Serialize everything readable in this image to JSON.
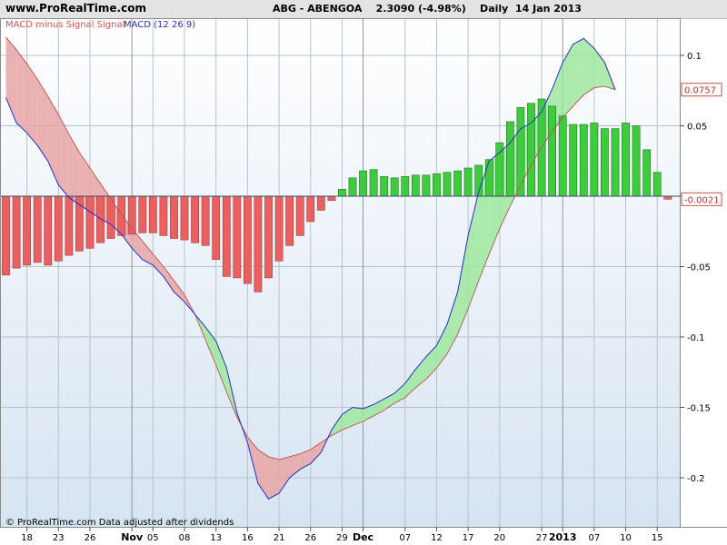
{
  "header": {
    "site": "www.ProRealTime.com",
    "title": "ABG - ABENGOA    2.3090 (-4.98%)    Daily  14 Jan 2013"
  },
  "footer_note": "© ProRealTime.com  Data adjusted after dividends",
  "colors": {
    "macd_line": "#2b2bd9",
    "signal_line": "#c05050",
    "pos_bar": "#3ecb3e",
    "neg_bar": "#e86060",
    "pos_fill": "#9ee89e",
    "neg_fill": "#e8a4a4",
    "grid": "#b8c2cc",
    "bg_top": "#ffffff",
    "bg_bottom": "#d6e4f1"
  },
  "chart_data": {
    "type": "bar",
    "title": "",
    "legend": [
      {
        "label": "MACD minus Signal Signal",
        "color": "#e05050"
      },
      {
        "label": "MACD (12 26 9)",
        "color": "#2b2bd9"
      }
    ],
    "legend_position": "top-left",
    "ylim": [
      -0.235,
      0.115
    ],
    "y_ticks": [
      0.1,
      0.05,
      0,
      -0.05,
      -0.1,
      -0.15,
      -0.2
    ],
    "y_tick_labels": [
      "0.1",
      "0.05",
      "0",
      "-0.05",
      "-0.1",
      "-0.15",
      "-0.2"
    ],
    "value_labels": {
      "macd": "0.0757",
      "histogram": "-0.0021"
    },
    "x_ticks": [
      {
        "label": "18",
        "i": 2
      },
      {
        "label": "23",
        "i": 5
      },
      {
        "label": "26",
        "i": 8
      },
      {
        "label": "Nov",
        "i": 12,
        "bold": true
      },
      {
        "label": "05",
        "i": 14
      },
      {
        "label": "08",
        "i": 17
      },
      {
        "label": "13",
        "i": 20
      },
      {
        "label": "16",
        "i": 23
      },
      {
        "label": "21",
        "i": 26
      },
      {
        "label": "26",
        "i": 29
      },
      {
        "label": "29",
        "i": 32
      },
      {
        "label": "Dec",
        "i": 34,
        "bold": true
      },
      {
        "label": "07",
        "i": 38
      },
      {
        "label": "12",
        "i": 41
      },
      {
        "label": "17",
        "i": 44
      },
      {
        "label": "20",
        "i": 47
      },
      {
        "label": "27",
        "i": 51
      },
      {
        "label": "2013",
        "i": 53,
        "bold": true
      },
      {
        "label": "07",
        "i": 56
      },
      {
        "label": "10",
        "i": 59
      },
      {
        "label": "15",
        "i": 62
      }
    ],
    "grid": true,
    "histogram": [
      -0.056,
      -0.051,
      -0.049,
      -0.047,
      -0.049,
      -0.046,
      -0.042,
      -0.039,
      -0.037,
      -0.033,
      -0.03,
      -0.028,
      -0.027,
      -0.026,
      -0.026,
      -0.028,
      -0.03,
      -0.031,
      -0.033,
      -0.035,
      -0.045,
      -0.057,
      -0.058,
      -0.062,
      -0.068,
      -0.058,
      -0.046,
      -0.035,
      -0.028,
      -0.018,
      -0.01,
      -0.003,
      0.005,
      0.013,
      0.018,
      0.019,
      0.014,
      0.013,
      0.014,
      0.015,
      0.015,
      0.016,
      0.017,
      0.018,
      0.02,
      0.022,
      0.026,
      0.038,
      0.053,
      0.063,
      0.066,
      0.069,
      0.064,
      0.057,
      0.051,
      0.051,
      0.052,
      0.048,
      0.048,
      0.052,
      0.05,
      0.033,
      0.017,
      -0.0021
    ],
    "macd": [
      0.07,
      0.052,
      0.045,
      0.036,
      0.025,
      0.008,
      -0.001,
      -0.006,
      -0.011,
      -0.016,
      -0.02,
      -0.027,
      -0.037,
      -0.045,
      -0.049,
      -0.057,
      -0.068,
      -0.075,
      -0.084,
      -0.093,
      -0.103,
      -0.122,
      -0.154,
      -0.175,
      -0.204,
      -0.215,
      -0.211,
      -0.2,
      -0.194,
      -0.19,
      -0.182,
      -0.166,
      -0.155,
      -0.15,
      -0.151,
      -0.148,
      -0.144,
      -0.14,
      -0.133,
      -0.123,
      -0.114,
      -0.106,
      -0.091,
      -0.068,
      -0.028,
      0.003,
      0.025,
      0.031,
      0.038,
      0.048,
      0.052,
      0.06,
      0.076,
      0.095,
      0.108,
      0.112,
      0.105,
      0.095,
      0.0757
    ],
    "signal": [
      0.113,
      0.104,
      0.094,
      0.083,
      0.071,
      0.058,
      0.044,
      0.031,
      0.02,
      0.009,
      -0.002,
      -0.013,
      -0.023,
      -0.032,
      -0.041,
      -0.05,
      -0.06,
      -0.07,
      -0.084,
      -0.102,
      -0.12,
      -0.139,
      -0.157,
      -0.171,
      -0.18,
      -0.185,
      -0.187,
      -0.185,
      -0.183,
      -0.18,
      -0.175,
      -0.17,
      -0.166,
      -0.163,
      -0.16,
      -0.156,
      -0.152,
      -0.147,
      -0.143,
      -0.136,
      -0.13,
      -0.122,
      -0.112,
      -0.098,
      -0.08,
      -0.06,
      -0.041,
      -0.023,
      -0.007,
      0.008,
      0.022,
      0.035,
      0.046,
      0.056,
      0.064,
      0.072,
      0.077,
      0.078,
      0.0757
    ]
  }
}
